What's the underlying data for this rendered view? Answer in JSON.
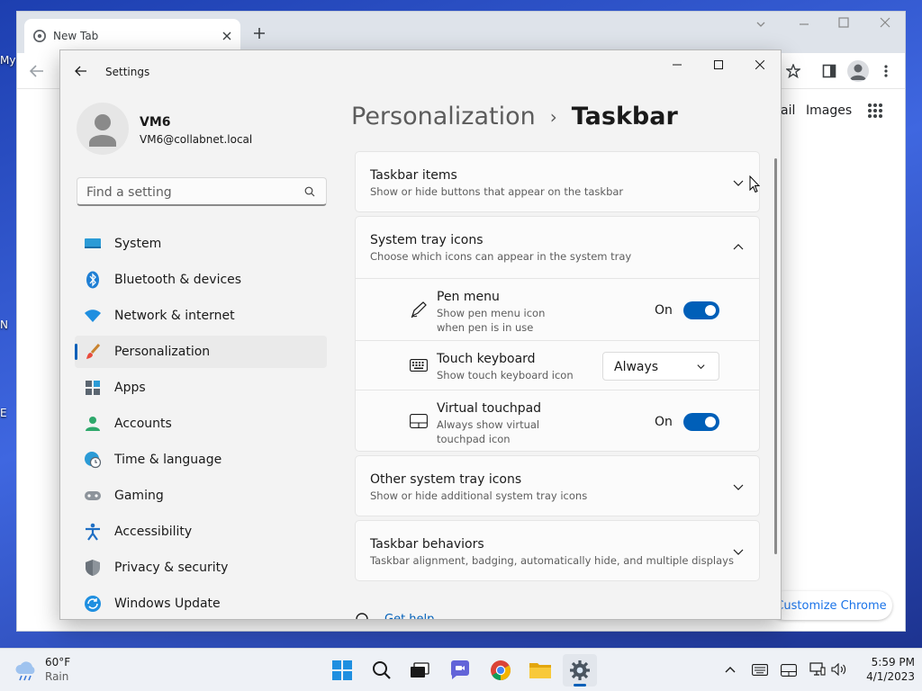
{
  "desktop": {
    "labels": [
      "My",
      "N",
      "E"
    ]
  },
  "chrome": {
    "tab_title": "New Tab",
    "links": {
      "gmail_fragment": "ail",
      "images": "Images"
    },
    "customize_label": "Customize Chrome"
  },
  "settings": {
    "window_title": "Settings",
    "user": {
      "name": "VM6",
      "email": "VM6@collabnet.local"
    },
    "search_placeholder": "Find a setting",
    "nav": [
      {
        "label": "System",
        "icon": "system-icon"
      },
      {
        "label": "Bluetooth & devices",
        "icon": "bluetooth-icon"
      },
      {
        "label": "Network & internet",
        "icon": "wifi-icon"
      },
      {
        "label": "Personalization",
        "icon": "paintbrush-icon",
        "active": true
      },
      {
        "label": "Apps",
        "icon": "apps-icon"
      },
      {
        "label": "Accounts",
        "icon": "accounts-icon"
      },
      {
        "label": "Time & language",
        "icon": "clock-globe-icon"
      },
      {
        "label": "Gaming",
        "icon": "gamepad-icon"
      },
      {
        "label": "Accessibility",
        "icon": "accessibility-icon"
      },
      {
        "label": "Privacy & security",
        "icon": "shield-icon"
      },
      {
        "label": "Windows Update",
        "icon": "update-icon"
      }
    ],
    "breadcrumb": {
      "parent": "Personalization",
      "separator": "›",
      "current": "Taskbar"
    },
    "sections": {
      "taskbar_items": {
        "title": "Taskbar items",
        "desc": "Show or hide buttons that appear on the taskbar"
      },
      "system_tray": {
        "title": "System tray icons",
        "desc": "Choose which icons can appear in the system tray",
        "items": {
          "pen_menu": {
            "title": "Pen menu",
            "desc_line1": "Show pen menu icon",
            "desc_line2": "when pen is in use",
            "state": "On"
          },
          "touch_keyboard": {
            "title": "Touch keyboard",
            "desc": "Show touch keyboard icon",
            "value": "Always"
          },
          "virtual_touchpad": {
            "title": "Virtual touchpad",
            "desc_line1": "Always show virtual",
            "desc_line2": "touchpad icon",
            "state": "On"
          }
        }
      },
      "other_tray": {
        "title": "Other system tray icons",
        "desc": "Show or hide additional system tray icons"
      },
      "behaviors": {
        "title": "Taskbar behaviors",
        "desc": "Taskbar alignment, badging, automatically hide, and multiple displays"
      }
    },
    "get_help": "Get help"
  },
  "taskbar": {
    "weather": {
      "temp": "60°F",
      "condition": "Rain"
    },
    "clock": {
      "time": "5:59 PM",
      "date": "4/1/2023"
    }
  },
  "colors": {
    "accent": "#005fb8",
    "chrome_link": "#1a73e8"
  }
}
